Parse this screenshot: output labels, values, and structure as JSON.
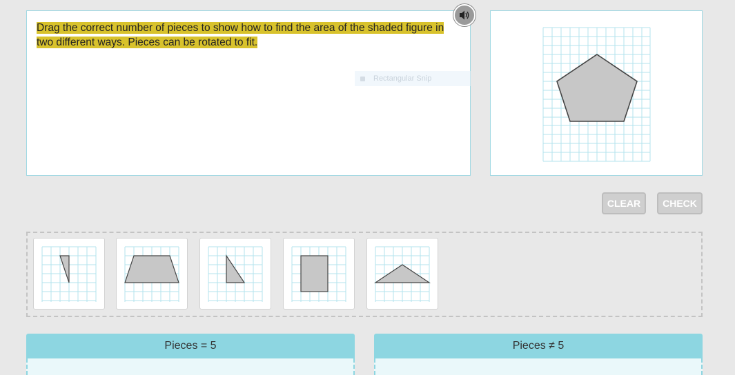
{
  "question": {
    "line1": "Drag the correct number of pieces to show how to find the area of the shaded figure in",
    "line2": "two different ways. Pieces can be rotated to fit."
  },
  "audio": {
    "icon": "speaker-icon"
  },
  "snip_overlay": {
    "label": "Rectangular Snip"
  },
  "buttons": {
    "clear": "CLEAR",
    "check": "CHECK"
  },
  "drop_zones": [
    {
      "header": "Pieces = 5"
    },
    {
      "header": "Pieces ≠ 5"
    }
  ],
  "colors": {
    "grid": "#b3e3ee",
    "shape_fill": "#c7c7c7",
    "shape_stroke": "#444444",
    "highlight": "#d8c22c",
    "drop_header": "#8dd6e1"
  }
}
